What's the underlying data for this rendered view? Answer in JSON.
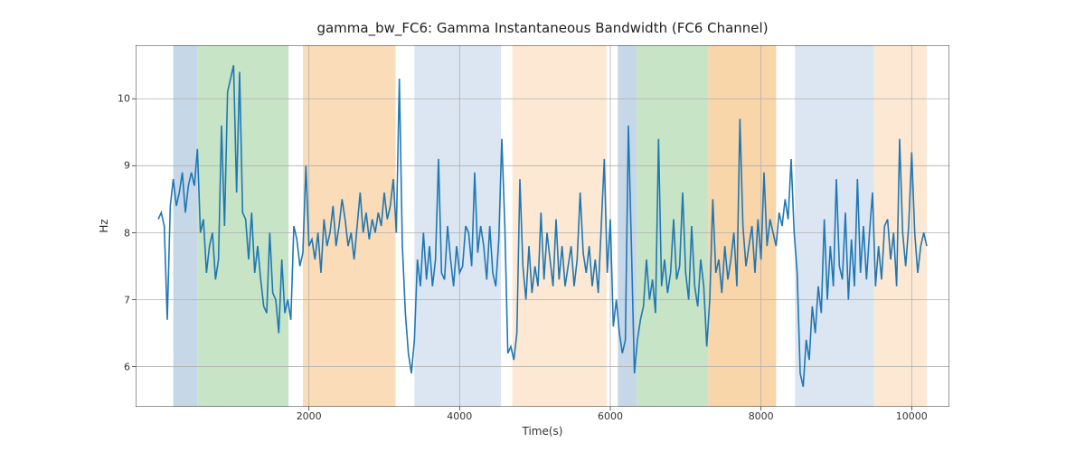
{
  "chart_data": {
    "type": "line",
    "title": "gamma_bw_FC6: Gamma Instantaneous Bandwidth (FC6 Channel)",
    "xlabel": "Time(s)",
    "ylabel": "Hz",
    "xlim": [
      -300,
      10500
    ],
    "ylim": [
      5.4,
      10.8
    ],
    "xticks": [
      2000,
      4000,
      6000,
      8000,
      10000
    ],
    "yticks": [
      6,
      7,
      8,
      9,
      10
    ],
    "line_color": "#1f77b4",
    "shaded_regions": [
      {
        "x0": 200,
        "x1": 520,
        "color": "#c6d7e8"
      },
      {
        "x0": 520,
        "x1": 1730,
        "color": "#c7e4c6"
      },
      {
        "x0": 1920,
        "x1": 3150,
        "color": "#fbdcb8"
      },
      {
        "x0": 3400,
        "x1": 4550,
        "color": "#dbe6f2"
      },
      {
        "x0": 4700,
        "x1": 5950,
        "color": "#fde9d3"
      },
      {
        "x0": 6100,
        "x1": 6350,
        "color": "#c6d7e8"
      },
      {
        "x0": 6350,
        "x1": 7300,
        "color": "#c7e4c6"
      },
      {
        "x0": 7300,
        "x1": 8200,
        "color": "#f9d5aa"
      },
      {
        "x0": 8450,
        "x1": 9500,
        "color": "#dbe6f2"
      },
      {
        "x0": 9500,
        "x1": 10200,
        "color": "#fde9d3"
      }
    ],
    "series": [
      {
        "name": "gamma_bw_FC6",
        "x": [
          0,
          40,
          80,
          120,
          160,
          200,
          240,
          280,
          320,
          360,
          400,
          440,
          480,
          520,
          560,
          600,
          640,
          680,
          720,
          760,
          800,
          840,
          880,
          920,
          960,
          1000,
          1040,
          1080,
          1120,
          1160,
          1200,
          1240,
          1280,
          1320,
          1360,
          1400,
          1440,
          1480,
          1520,
          1560,
          1600,
          1640,
          1680,
          1720,
          1760,
          1800,
          1840,
          1880,
          1920,
          1960,
          2000,
          2040,
          2080,
          2120,
          2160,
          2200,
          2240,
          2280,
          2320,
          2360,
          2400,
          2440,
          2480,
          2520,
          2560,
          2600,
          2640,
          2680,
          2720,
          2760,
          2800,
          2840,
          2880,
          2920,
          2960,
          3000,
          3040,
          3080,
          3120,
          3160,
          3200,
          3240,
          3280,
          3320,
          3360,
          3400,
          3440,
          3480,
          3520,
          3560,
          3600,
          3640,
          3680,
          3720,
          3760,
          3800,
          3840,
          3880,
          3920,
          3960,
          4000,
          4040,
          4080,
          4120,
          4160,
          4200,
          4240,
          4280,
          4320,
          4360,
          4400,
          4440,
          4480,
          4520,
          4560,
          4600,
          4640,
          4680,
          4720,
          4760,
          4800,
          4840,
          4880,
          4920,
          4960,
          5000,
          5040,
          5080,
          5120,
          5160,
          5200,
          5240,
          5280,
          5320,
          5360,
          5400,
          5440,
          5480,
          5520,
          5560,
          5600,
          5640,
          5680,
          5720,
          5760,
          5800,
          5840,
          5880,
          5920,
          5960,
          6000,
          6040,
          6080,
          6120,
          6160,
          6200,
          6240,
          6280,
          6320,
          6360,
          6400,
          6440,
          6480,
          6520,
          6560,
          6600,
          6640,
          6680,
          6720,
          6760,
          6800,
          6840,
          6880,
          6920,
          6960,
          7000,
          7040,
          7080,
          7120,
          7160,
          7200,
          7240,
          7280,
          7320,
          7360,
          7400,
          7440,
          7480,
          7520,
          7560,
          7600,
          7640,
          7680,
          7720,
          7760,
          7800,
          7840,
          7880,
          7920,
          7960,
          8000,
          8040,
          8080,
          8120,
          8160,
          8200,
          8240,
          8280,
          8320,
          8360,
          8400,
          8440,
          8480,
          8520,
          8560,
          8600,
          8640,
          8680,
          8720,
          8760,
          8800,
          8840,
          8880,
          8920,
          8960,
          9000,
          9040,
          9080,
          9120,
          9160,
          9200,
          9240,
          9280,
          9320,
          9360,
          9400,
          9440,
          9480,
          9520,
          9560,
          9600,
          9640,
          9680,
          9720,
          9760,
          9800,
          9840,
          9880,
          9920,
          9960,
          10000,
          10040,
          10080,
          10120,
          10160,
          10200
        ],
        "y": [
          8.2,
          8.3,
          8.1,
          6.7,
          8.4,
          8.8,
          8.4,
          8.6,
          8.9,
          8.3,
          8.7,
          8.9,
          8.7,
          9.25,
          8.0,
          8.2,
          7.4,
          7.8,
          8.0,
          7.3,
          7.6,
          9.6,
          8.1,
          10.1,
          10.3,
          10.5,
          8.6,
          10.4,
          8.3,
          8.2,
          7.6,
          8.3,
          7.4,
          7.8,
          7.3,
          6.9,
          6.8,
          8.0,
          7.1,
          7.0,
          6.5,
          7.6,
          6.8,
          7.0,
          6.7,
          8.1,
          7.9,
          7.5,
          7.7,
          9.0,
          7.8,
          7.9,
          7.6,
          8.0,
          7.4,
          8.2,
          7.8,
          8.0,
          8.4,
          7.8,
          8.1,
          8.5,
          8.2,
          7.8,
          8.0,
          7.6,
          8.1,
          8.6,
          8.0,
          8.3,
          7.9,
          8.2,
          8.0,
          8.3,
          8.1,
          8.6,
          8.2,
          8.4,
          8.8,
          8.0,
          10.3,
          7.8,
          6.8,
          6.2,
          5.9,
          6.4,
          7.6,
          7.2,
          8.0,
          7.3,
          7.8,
          7.2,
          7.6,
          9.1,
          7.4,
          7.3,
          8.1,
          7.6,
          7.2,
          7.8,
          7.4,
          7.5,
          8.1,
          8.0,
          7.5,
          8.9,
          7.7,
          8.1,
          7.8,
          7.3,
          8.1,
          7.4,
          7.2,
          7.9,
          9.4,
          8.1,
          6.2,
          6.3,
          6.1,
          6.5,
          8.8,
          7.5,
          7.0,
          7.8,
          7.1,
          7.5,
          7.2,
          8.3,
          7.3,
          8.0,
          7.6,
          7.2,
          8.2,
          7.3,
          7.8,
          7.2,
          7.5,
          7.8,
          7.2,
          7.6,
          8.6,
          7.7,
          7.4,
          7.8,
          7.2,
          7.6,
          7.1,
          8.1,
          9.1,
          7.4,
          8.2,
          6.6,
          7.0,
          6.5,
          6.2,
          6.4,
          9.6,
          7.8,
          5.9,
          6.4,
          6.7,
          6.9,
          7.6,
          7.0,
          7.3,
          6.8,
          9.4,
          7.2,
          7.6,
          7.1,
          7.4,
          8.2,
          7.3,
          7.5,
          8.6,
          7.4,
          7.0,
          8.1,
          7.2,
          6.9,
          7.6,
          7.2,
          6.3,
          7.0,
          8.5,
          7.4,
          7.6,
          7.1,
          7.8,
          7.3,
          7.6,
          8.0,
          7.2,
          9.7,
          8.1,
          7.5,
          7.8,
          8.1,
          7.4,
          8.2,
          7.6,
          8.9,
          7.8,
          8.2,
          8.0,
          7.8,
          8.3,
          8.1,
          8.5,
          8.2,
          9.1,
          8.0,
          7.4,
          5.9,
          5.7,
          6.4,
          6.1,
          6.9,
          6.5,
          7.2,
          6.8,
          8.2,
          7.0,
          7.8,
          7.2,
          8.8,
          7.5,
          7.3,
          8.3,
          7.0,
          7.9,
          7.2,
          8.8,
          7.4,
          8.1,
          7.3,
          8.0,
          8.6,
          7.2,
          7.8,
          7.3,
          8.1,
          8.2,
          7.6,
          8.0,
          7.2,
          9.4,
          8.0,
          7.5,
          8.1,
          9.2,
          8.0,
          7.4,
          7.8,
          8.0,
          7.8
        ]
      }
    ]
  }
}
